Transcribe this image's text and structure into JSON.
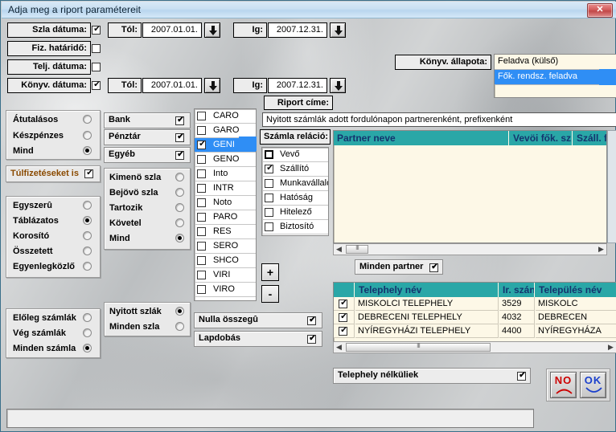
{
  "window": {
    "title": "Adja meg a riport paramétereit",
    "close_label": "✕"
  },
  "dates": {
    "rows": [
      {
        "label": "Szla dátuma:",
        "checked": true,
        "from_label": "Tól:",
        "from_value": "2007.01.01.",
        "to_label": "Ig:",
        "to_value": "2007.12.31."
      },
      {
        "label": "Fiz. határidő:",
        "checked": false
      },
      {
        "label": "Telj. dátuma:",
        "checked": false
      },
      {
        "label": "Könyv. dátuma:",
        "checked": true,
        "from_label": "Tól:",
        "from_value": "2007.01.01.",
        "to_label": "Ig:",
        "to_value": "2007.12.31."
      }
    ]
  },
  "konyv_allapota": {
    "label": "Könyv. állapota:",
    "items": [
      {
        "label": "Feladva (külső)",
        "selected": false
      },
      {
        "label": "Fők. rendsz. feladva",
        "selected": true
      }
    ]
  },
  "riport": {
    "label": "Riport címe:",
    "value": "Nyitott számlák adott fordulónapon partnerenként, prefixenként"
  },
  "payment_mode": {
    "items": [
      {
        "label": "Átutalásos",
        "selected": false
      },
      {
        "label": "Készpénzes",
        "selected": false
      },
      {
        "label": "Mind",
        "selected": true
      }
    ]
  },
  "overpay": {
    "label": "Túlfizetéseket is",
    "checked": true
  },
  "report_style": {
    "items": [
      {
        "label": "Egyszerû",
        "selected": false
      },
      {
        "label": "Táblázatos",
        "selected": true
      },
      {
        "label": "Korosító",
        "selected": false
      },
      {
        "label": "Összetett",
        "selected": false
      },
      {
        "label": "Egyenlegközlő",
        "selected": false
      }
    ]
  },
  "invoice_kind": {
    "items": [
      {
        "label": "Előleg számlák",
        "selected": false
      },
      {
        "label": "Vég számlák",
        "selected": false
      },
      {
        "label": "Minden számla",
        "selected": true
      }
    ]
  },
  "accounts": {
    "items": [
      {
        "label": "Bank",
        "checked": true
      },
      {
        "label": "Pénztár",
        "checked": true
      },
      {
        "label": "Egyéb",
        "checked": true
      }
    ]
  },
  "direction": {
    "items": [
      {
        "label": "Kimenö szla",
        "selected": false
      },
      {
        "label": "Bejövö szla",
        "selected": false
      },
      {
        "label": "Tartozik",
        "selected": false
      },
      {
        "label": "Követel",
        "selected": false
      },
      {
        "label": "Mind",
        "selected": true
      }
    ]
  },
  "open_state": {
    "items": [
      {
        "label": "Nyitott szlák",
        "selected": true
      },
      {
        "label": "Minden szla",
        "selected": false
      }
    ]
  },
  "prefixes": {
    "items": [
      {
        "label": "CARO",
        "checked": false,
        "selected": false
      },
      {
        "label": "GARO",
        "checked": false,
        "selected": false
      },
      {
        "label": "GENI",
        "checked": true,
        "selected": true
      },
      {
        "label": "GENO",
        "checked": false,
        "selected": false
      },
      {
        "label": "Into",
        "checked": false,
        "selected": false
      },
      {
        "label": "INTR",
        "checked": false,
        "selected": false
      },
      {
        "label": "Noto",
        "checked": false,
        "selected": false
      },
      {
        "label": "PARO",
        "checked": false,
        "selected": false
      },
      {
        "label": "RES",
        "checked": false,
        "selected": false
      },
      {
        "label": "SERO",
        "checked": false,
        "selected": false
      },
      {
        "label": "SHCO",
        "checked": false,
        "selected": false
      },
      {
        "label": "VIRI",
        "checked": false,
        "selected": false
      },
      {
        "label": "VIRO",
        "checked": false,
        "selected": false
      }
    ]
  },
  "zero_amount": {
    "label": "Nulla összegû",
    "checked": true
  },
  "page_break": {
    "label": "Lapdobás",
    "checked": true
  },
  "relation": {
    "label": "Számla reláció:",
    "items": [
      {
        "label": "Vevő",
        "checked": false,
        "focused": true
      },
      {
        "label": "Szállító",
        "checked": true,
        "focused": false
      },
      {
        "label": "Munkavállaló",
        "checked": false,
        "focused": false
      },
      {
        "label": "Hatóság",
        "checked": false,
        "focused": false
      },
      {
        "label": "Hitelező",
        "checked": false,
        "focused": false
      },
      {
        "label": "Biztosító",
        "checked": false,
        "focused": false
      }
    ]
  },
  "addremove": {
    "plus": "+",
    "minus": "-"
  },
  "partner_grid": {
    "columns": [
      "Partner neve",
      "Vevöi fők. sz",
      "Száll. fő"
    ],
    "rows": []
  },
  "all_partners": {
    "label": "Minden partner",
    "checked": true
  },
  "site_grid": {
    "columns": [
      "",
      "Telephely név",
      "Ir. szán",
      "Település név"
    ],
    "rows": [
      {
        "checked": true,
        "name": "MISKOLCI TELEPHELY",
        "zip": "3529",
        "city": "MISKOLC"
      },
      {
        "checked": true,
        "name": "DEBRECENI TELEPHELY",
        "zip": "4032",
        "city": "DEBRECEN"
      },
      {
        "checked": true,
        "name": "NYÍREGYHÁZI TELEPHELY",
        "zip": "4400",
        "city": "NYÍREGYHÁZA"
      }
    ]
  },
  "no_site": {
    "label": "Telephely nélküliek",
    "checked": true
  },
  "buttons": {
    "no": "NO",
    "ok": "OK"
  },
  "status": {
    "text": ""
  },
  "colors": {
    "titlebar": "#c9e0f2",
    "selection": "#2f8ef5",
    "grid_header": "#2aa7a7",
    "grid_bg": "#fdf8e7",
    "no_red": "#cc0000",
    "ok_blue": "#1a3fcc"
  }
}
